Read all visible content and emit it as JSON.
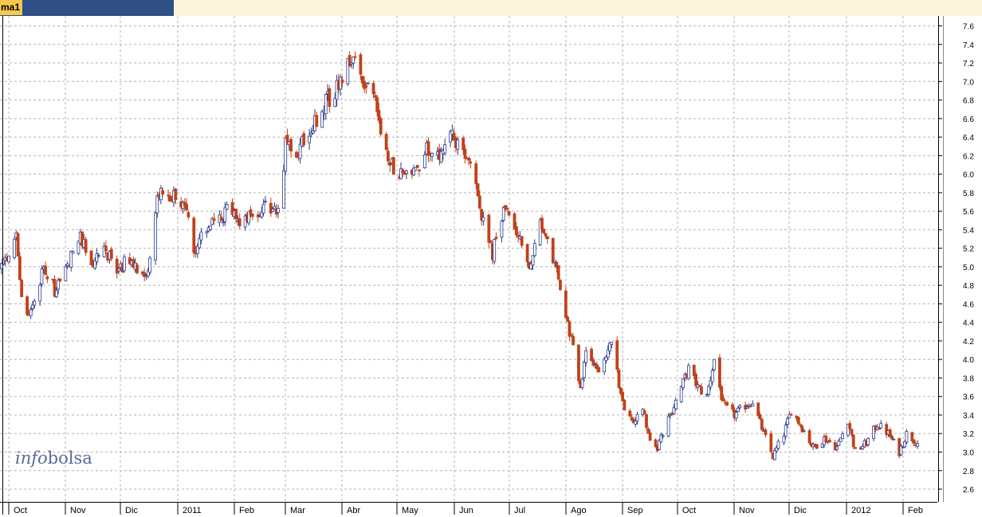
{
  "header": {
    "tab_label": "ma1"
  },
  "watermark": {
    "part1": "info",
    "part2": "bolsa"
  },
  "colors": {
    "up": "#2b3b8f",
    "down": "#c0421a",
    "grid": "#b4b4b4",
    "watermark": "#5a6a9a",
    "topbar": "#fff5dc",
    "tab": "#2f4f87"
  },
  "chart_data": {
    "type": "candlestick",
    "grid": true,
    "ylim": [
      2.5,
      7.7
    ],
    "y_ticks": [
      "2.6",
      "2.8",
      "3.0",
      "3.2",
      "3.4",
      "3.6",
      "3.8",
      "4.0",
      "4.2",
      "4.4",
      "4.6",
      "4.8",
      "5.0",
      "5.2",
      "5.4",
      "5.6",
      "5.8",
      "6.0",
      "6.2",
      "6.4",
      "6.6",
      "6.8",
      "7.0",
      "7.2",
      "7.4",
      "7.6"
    ],
    "x_ticks": [
      "Oct",
      "Nov",
      "Dic",
      "2011",
      "Feb",
      "Mar",
      "Abr",
      "May",
      "Jun",
      "Jul",
      "Ago",
      "Sep",
      "Oct",
      "Nov",
      "Dic",
      "2012",
      "Feb"
    ],
    "price_path": [
      [
        "2010-09-27",
        5.0
      ],
      [
        "2010-10-01",
        5.1
      ],
      [
        "2010-10-05",
        5.4
      ],
      [
        "2010-10-08",
        4.7
      ],
      [
        "2010-10-11",
        4.45
      ],
      [
        "2010-10-15",
        4.6
      ],
      [
        "2010-10-20",
        5.0
      ],
      [
        "2010-10-26",
        4.75
      ],
      [
        "2010-11-02",
        5.0
      ],
      [
        "2010-11-08",
        5.35
      ],
      [
        "2010-11-15",
        5.05
      ],
      [
        "2010-11-22",
        5.2
      ],
      [
        "2010-11-29",
        4.95
      ],
      [
        "2010-12-06",
        5.1
      ],
      [
        "2010-12-13",
        4.85
      ],
      [
        "2010-12-16",
        5.0
      ],
      [
        "2010-12-21",
        5.75
      ],
      [
        "2010-12-27",
        5.8
      ],
      [
        "2011-01-03",
        5.7
      ],
      [
        "2011-01-07",
        5.5
      ],
      [
        "2011-01-11",
        5.1
      ],
      [
        "2011-01-14",
        5.4
      ],
      [
        "2011-01-21",
        5.45
      ],
      [
        "2011-01-28",
        5.6
      ],
      [
        "2011-02-04",
        5.5
      ],
      [
        "2011-02-11",
        5.55
      ],
      [
        "2011-02-18",
        5.7
      ],
      [
        "2011-02-25",
        5.55
      ],
      [
        "2011-03-01",
        6.3
      ],
      [
        "2011-03-07",
        6.2
      ],
      [
        "2011-03-14",
        6.5
      ],
      [
        "2011-03-18",
        6.6
      ],
      [
        "2011-03-24",
        6.8
      ],
      [
        "2011-03-31",
        7.0
      ],
      [
        "2011-04-07",
        7.3
      ],
      [
        "2011-04-12",
        7.05
      ],
      [
        "2011-04-19",
        6.8
      ],
      [
        "2011-04-26",
        6.1
      ],
      [
        "2011-05-03",
        6.05
      ],
      [
        "2011-05-10",
        6.0
      ],
      [
        "2011-05-17",
        6.3
      ],
      [
        "2011-05-24",
        6.2
      ],
      [
        "2011-05-30",
        6.5
      ],
      [
        "2011-06-03",
        6.3
      ],
      [
        "2011-06-10",
        6.1
      ],
      [
        "2011-06-17",
        5.5
      ],
      [
        "2011-06-22",
        5.15
      ],
      [
        "2011-06-27",
        5.55
      ],
      [
        "2011-07-01",
        5.6
      ],
      [
        "2011-07-06",
        5.35
      ],
      [
        "2011-07-12",
        5.0
      ],
      [
        "2011-07-18",
        5.45
      ],
      [
        "2011-07-22",
        5.3
      ],
      [
        "2011-07-29",
        4.8
      ],
      [
        "2011-08-04",
        4.2
      ],
      [
        "2011-08-09",
        3.7
      ],
      [
        "2011-08-12",
        4.1
      ],
      [
        "2011-08-19",
        3.85
      ],
      [
        "2011-08-26",
        4.2
      ],
      [
        "2011-09-01",
        3.5
      ],
      [
        "2011-09-06",
        3.3
      ],
      [
        "2011-09-12",
        3.5
      ],
      [
        "2011-09-16",
        3.1
      ],
      [
        "2011-09-20",
        3.05
      ],
      [
        "2011-09-26",
        3.35
      ],
      [
        "2011-10-03",
        3.7
      ],
      [
        "2011-10-07",
        3.9
      ],
      [
        "2011-10-12",
        3.7
      ],
      [
        "2011-10-17",
        3.6
      ],
      [
        "2011-10-21",
        4.0
      ],
      [
        "2011-10-26",
        3.5
      ],
      [
        "2011-11-01",
        3.4
      ],
      [
        "2011-11-07",
        3.5
      ],
      [
        "2011-11-11",
        3.55
      ],
      [
        "2011-11-17",
        3.2
      ],
      [
        "2011-11-22",
        2.95
      ],
      [
        "2011-11-28",
        3.2
      ],
      [
        "2011-12-02",
        3.45
      ],
      [
        "2011-12-07",
        3.3
      ],
      [
        "2011-12-14",
        3.05
      ],
      [
        "2011-12-20",
        3.15
      ],
      [
        "2011-12-27",
        3.05
      ],
      [
        "2012-01-02",
        3.35
      ],
      [
        "2012-01-06",
        3.0
      ],
      [
        "2012-01-12",
        3.1
      ],
      [
        "2012-01-18",
        3.3
      ],
      [
        "2012-01-24",
        3.2
      ],
      [
        "2012-01-30",
        3.0
      ],
      [
        "2012-02-03",
        3.2
      ],
      [
        "2012-02-09",
        3.1
      ]
    ]
  }
}
